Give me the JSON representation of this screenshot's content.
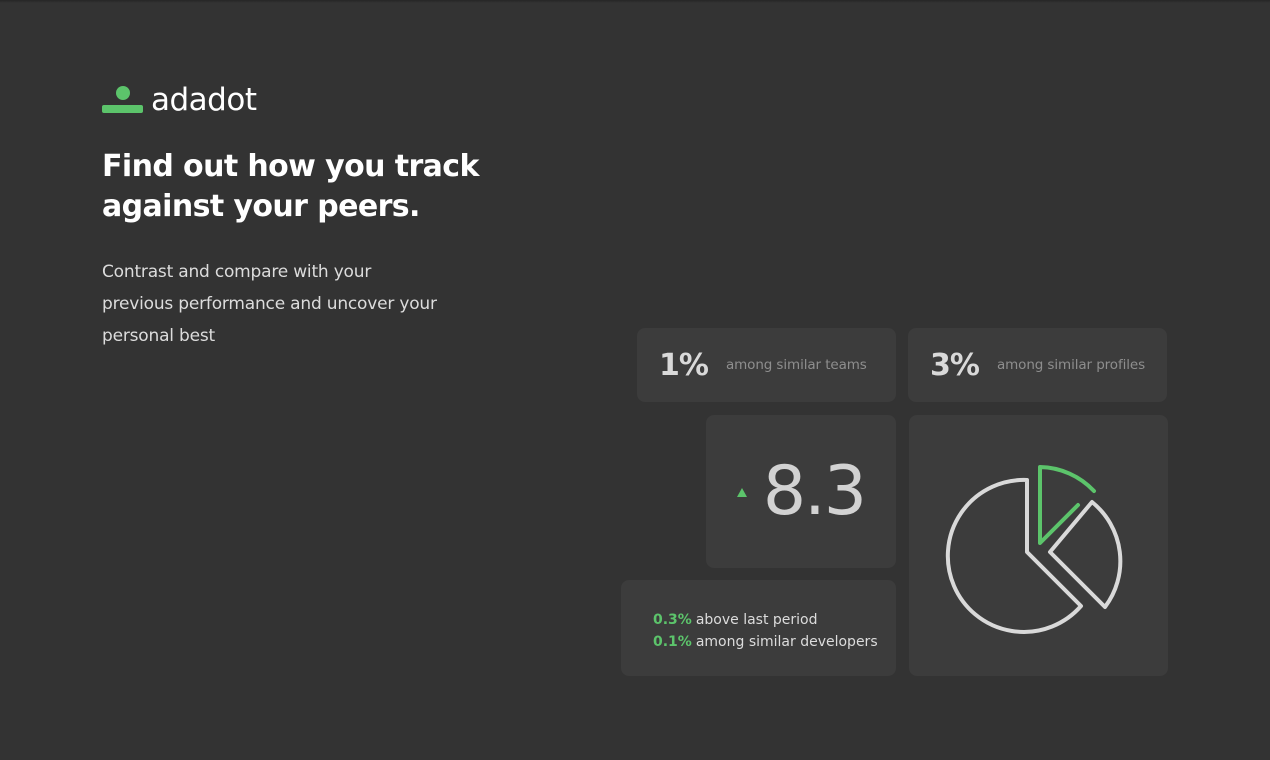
{
  "brand": {
    "name": "adadot",
    "accent": "#5cc46b",
    "logo_icon": "adadot-logo-icon"
  },
  "hero": {
    "headline": "Find out how you track against your peers.",
    "subtext": "Contrast and compare with your previous performance and uncover your personal best"
  },
  "stats": {
    "teams": {
      "value": "1%",
      "label": "among similar teams"
    },
    "profiles": {
      "value": "3%",
      "label": "among similar profiles"
    }
  },
  "score": {
    "value": "8.3",
    "trend_icon": "trend-up-icon",
    "trend_color": "#5cc46b"
  },
  "comparison": {
    "line1": {
      "value": "0.3%",
      "label": "above last period"
    },
    "line2": {
      "value": "0.1%",
      "label": "among similar developers"
    }
  },
  "pie": {
    "icon": "pie-chart-icon",
    "highlight_color": "#5cc46b",
    "outline_color": "#d9d9d9"
  },
  "colors": {
    "background": "#333333",
    "card": "#3c3c3c"
  }
}
